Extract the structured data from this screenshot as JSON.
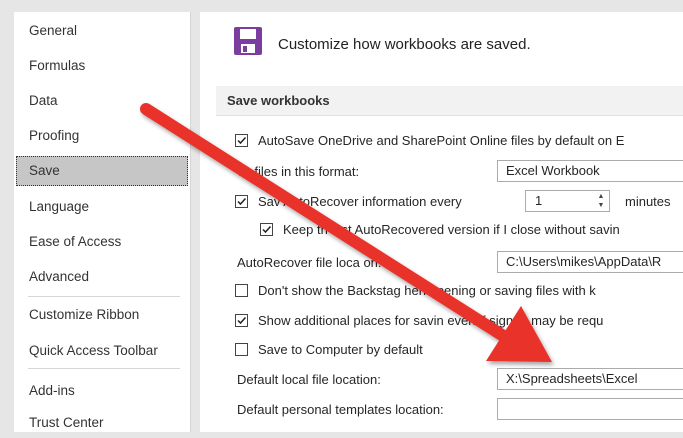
{
  "sidebar": {
    "items": [
      {
        "label": "General"
      },
      {
        "label": "Formulas"
      },
      {
        "label": "Data"
      },
      {
        "label": "Proofing"
      },
      {
        "label": "Save"
      },
      {
        "label": "Language"
      },
      {
        "label": "Ease of Access"
      },
      {
        "label": "Advanced"
      },
      {
        "label": "Customize Ribbon"
      },
      {
        "label": "Quick Access Toolbar"
      },
      {
        "label": "Add-ins"
      },
      {
        "label": "Trust Center"
      }
    ],
    "selected": "Save"
  },
  "header": {
    "icon": "save-disk-icon",
    "title": "Customize how workbooks are saved.",
    "icon_color": "#7b3ea0"
  },
  "section": {
    "title": "Save workbooks"
  },
  "options": {
    "autosave_label": "AutoSave OneDrive and SharePoint Online files by default on E",
    "autosave_checked": true,
    "save_format_label": "ve files in this format:",
    "save_format_value": "Excel Workbook",
    "autorecover_label": "Sav AutoRecover information every",
    "autorecover_checked": true,
    "autorecover_minutes": "1",
    "minutes_label": "minutes",
    "keep_last_label": "Keep th last AutoRecovered version if I close without savin",
    "keep_last_checked": true,
    "autorecover_location_label": "AutoRecover file loca on:",
    "autorecover_location_value": "C:\\Users\\mikes\\AppData\\R",
    "backstage_label": "Don't show the Backstag hen opening or saving files with k",
    "backstage_checked": false,
    "additional_places_label": "Show additional places for savin even if sign-in may be requ",
    "additional_places_checked": true,
    "save_computer_label": "Save to Computer by default",
    "save_computer_checked": false,
    "default_local_label": "Default local file location:",
    "default_local_value": "X:\\Spreadsheets\\Excel",
    "default_templates_label": "Default personal templates location:",
    "default_templates_value": ""
  },
  "annotation": {
    "arrow_color": "#e8322a",
    "arrow_icon": "red-arrow-annotation"
  }
}
